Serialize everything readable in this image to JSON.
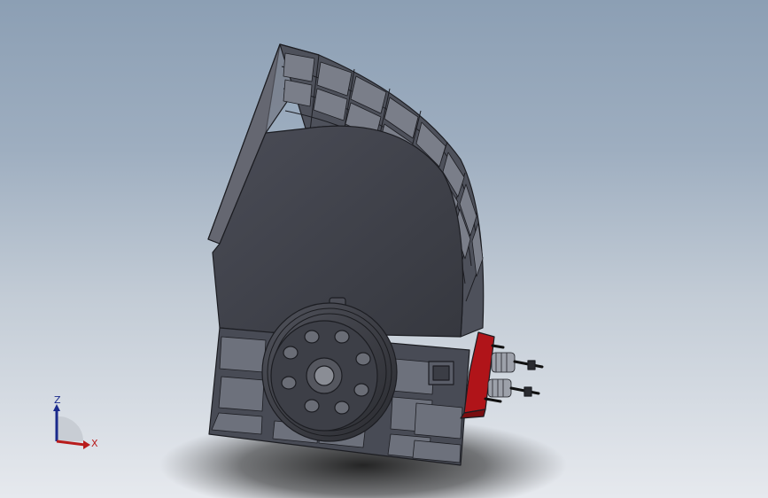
{
  "viewport": {
    "background_top": "#8c9fb4",
    "background_bottom": "#e6e9ee"
  },
  "model": {
    "body_color": "#3e4049",
    "edge_color": "#1c1d22",
    "panel_color": "#5a5d68",
    "adjuster_color": "#b01419"
  },
  "triad": {
    "z_label": "Z",
    "x_label": "X",
    "z_color": "#1a2a8c",
    "x_color": "#b81c1c"
  }
}
